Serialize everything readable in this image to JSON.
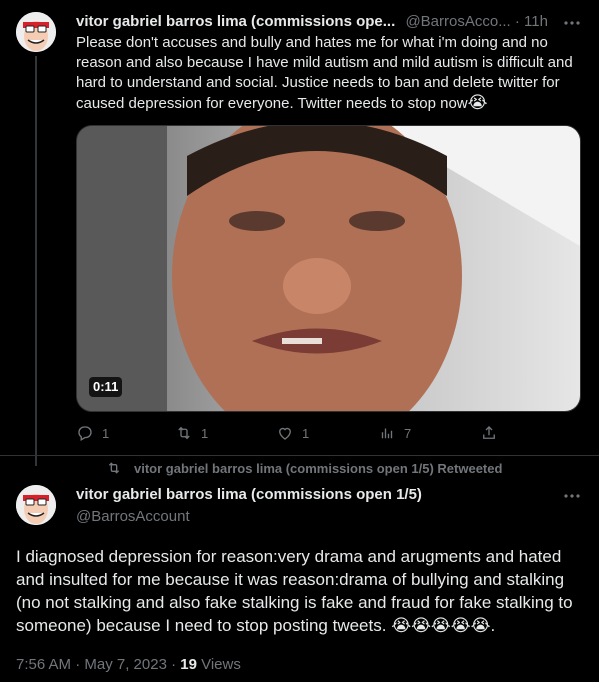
{
  "colors": {
    "background": "#000000",
    "text": "#e7e9ea",
    "muted": "#71767b",
    "divider": "#2f3336"
  },
  "tweet1": {
    "name": "vitor gabriel barros lima (commissions ope...",
    "handle": "@BarrosAcco...",
    "dot": "·",
    "time": "11h",
    "more_icon": "more-horizontal-icon",
    "text": "Please don't accuses and bully and hates me for what i'm doing and no reason and also because I have mild autism and mild autism is difficult and hard to understand and social. Justice needs to ban and delete twitter for caused depression for everyone. Twitter needs to stop now",
    "text_emoji": "😭",
    "video_duration": "0:11",
    "actions": {
      "reply_count": "1",
      "retweet_count": "1",
      "like_count": "1",
      "views_count": "7"
    }
  },
  "retweet_label": "vitor gabriel barros lima (commissions open 1/5) Retweeted",
  "tweet2": {
    "name": "vitor gabriel barros lima (commissions open 1/5)",
    "handle": "@BarrosAccount",
    "text": "I diagnosed depression for reason:very drama and arugments and hated and insulted for me because it was reason:drama of bullying and stalking (no not stalking and also fake stalking is fake and fraud for fake stalking to someone) because I need to stop posting tweets.",
    "emojis": "😭😭😭😭😭",
    "text_end": ".",
    "timestamp": "7:56 AM · May 7, 2023 · ",
    "views_count": "19",
    "views_label": "Views"
  }
}
